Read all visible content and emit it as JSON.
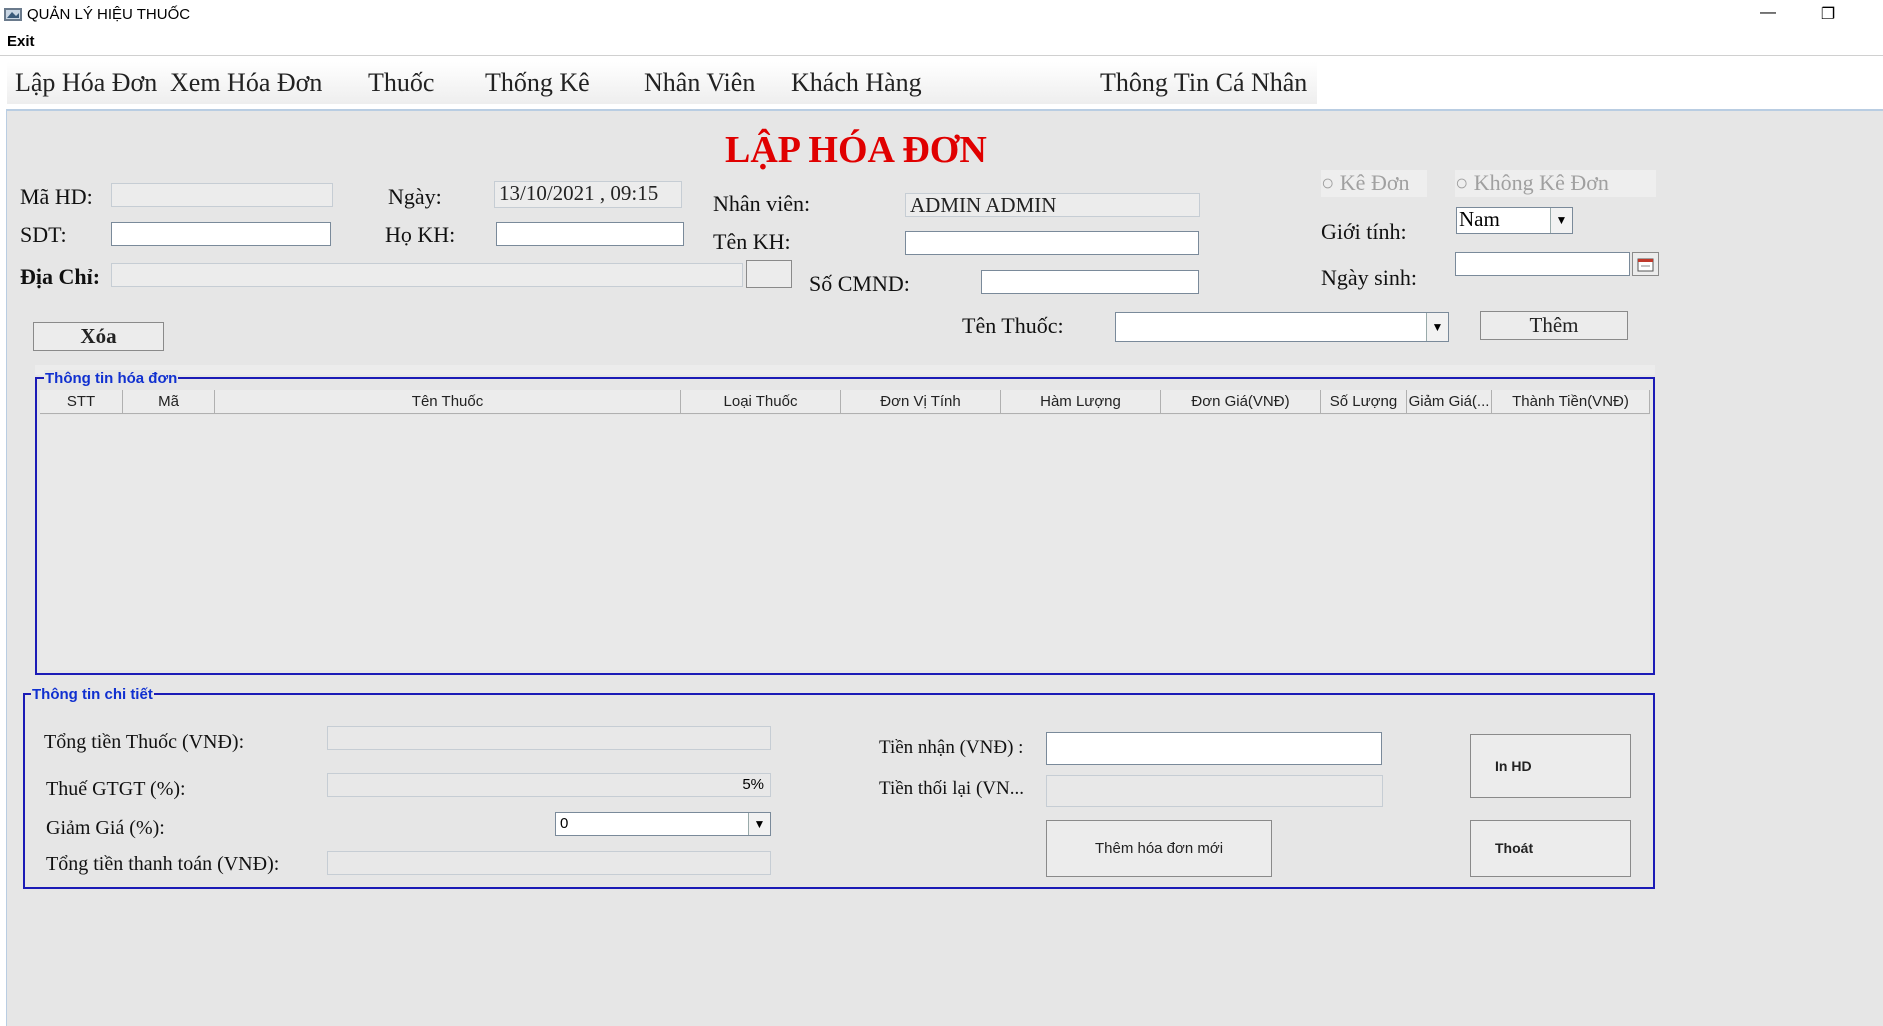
{
  "window": {
    "title": "QUẢN LÝ HIỆU THUỐC",
    "minimize": "—",
    "restore": "❐"
  },
  "menu": {
    "exit": "Exit"
  },
  "nav": [
    "Lập Hóa Đơn",
    "Xem Hóa Đơn",
    "Thuốc",
    "Thống Kê",
    "Nhân Viên",
    "Khách Hàng",
    "Thông Tin Cá Nhân"
  ],
  "page_title": "LẬP HÓA ĐƠN",
  "form": {
    "ma_hd_label": "Mã HD:",
    "ma_hd_value": "",
    "ngay_label": "Ngày:",
    "ngay_value": "13/10/2021 , 09:15",
    "sdt_label": "SDT:",
    "sdt_value": "",
    "ho_kh_label": "Họ KH:",
    "ho_kh_value": "",
    "dia_chi_label": "Địa Chỉ:",
    "dia_chi_value": "",
    "nhan_vien_label": "Nhân viên:",
    "nhan_vien_value": "ADMIN ADMIN",
    "ten_kh_label": "Tên KH:",
    "ten_kh_value": "",
    "so_cmnd_label": "Số CMND:",
    "so_cmnd_value": "",
    "ke_don": "Kê Đơn",
    "khong_ke_don": "Không Kê Đơn",
    "gioi_tinh_label": "Giới tính:",
    "gioi_tinh_value": "Nam",
    "ngay_sinh_label": "Ngày sinh:",
    "ngay_sinh_value": "",
    "xoa_button": "Xóa",
    "ten_thuoc_label": "Tên Thuốc:",
    "ten_thuoc_value": "",
    "them_button": "Thêm"
  },
  "invoice_table": {
    "title": "Thông tin hóa đơn",
    "columns": [
      "STT",
      "Mã",
      "Tên Thuốc",
      "Loại Thuốc",
      "Đơn Vị Tính",
      "Hàm Lượng",
      "Đơn Giá(VNĐ)",
      "Số Lượng",
      "Giảm Giá(...",
      "Thành Tiền(VNĐ)"
    ],
    "rows": []
  },
  "details": {
    "title": "Thông tin chi tiết",
    "tong_tien_thuoc_label": "Tổng tiền Thuốc (VNĐ):",
    "tong_tien_thuoc_value": "",
    "thue_label": "Thuế GTGT (%):",
    "thue_value": "5%",
    "giam_gia_label": "Giảm Giá (%):",
    "giam_gia_value": "0",
    "tong_thanh_toan_label": "Tổng tiền thanh toán (VNĐ):",
    "tong_thanh_toan_value": "",
    "tien_nhan_label": "Tiền nhận (VNĐ) :",
    "tien_nhan_value": "",
    "tien_thoi_label": "Tiền thối lại (VN...",
    "tien_thoi_value": "",
    "them_hd_moi_button": "Thêm hóa đơn mới",
    "in_hd_button": "In HD",
    "thoat_button": "Thoát"
  },
  "icons": {
    "combo_arrow": "chevron-down-icon",
    "calendar": "calendar-icon",
    "app": "app-icon"
  },
  "colors": {
    "title_red": "#e00000",
    "group_border": "#1b1bb6",
    "group_title": "#1030d0",
    "panel_bg": "#e6e6e6"
  }
}
